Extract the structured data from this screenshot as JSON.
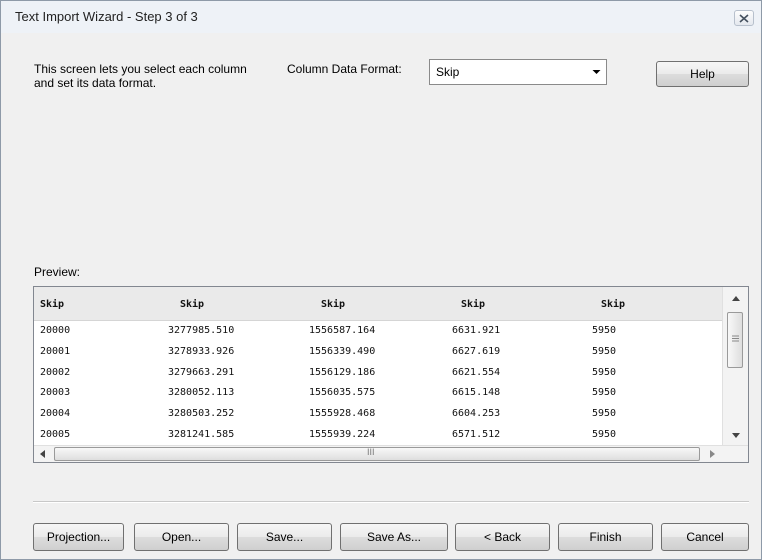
{
  "window": {
    "title": "Text Import Wizard - Step 3 of 3"
  },
  "description": "This screen lets you select each column and set its data format.",
  "column_format": {
    "label": "Column Data Format:",
    "value": "Skip"
  },
  "help_label": "Help",
  "preview": {
    "label": "Preview:",
    "headers": [
      "Skip",
      "Skip",
      "Skip",
      "Skip",
      "Skip"
    ],
    "rows": [
      [
        "20000",
        "3277985.510",
        "1556587.164",
        "6631.921",
        "5950"
      ],
      [
        "20001",
        "3278933.926",
        "1556339.490",
        "6627.619",
        "5950"
      ],
      [
        "20002",
        "3279663.291",
        "1556129.186",
        "6621.554",
        "5950"
      ],
      [
        "20003",
        "3280052.113",
        "1556035.575",
        "6615.148",
        "5950"
      ],
      [
        "20004",
        "3280503.252",
        "1555928.468",
        "6604.253",
        "5950"
      ],
      [
        "20005",
        "3281241.585",
        "1555939.224",
        "6571.512",
        "5950"
      ]
    ],
    "scroll_grip": "III"
  },
  "buttons": {
    "projection": "Projection...",
    "open": "Open...",
    "save": "Save...",
    "save_as": "Save As...",
    "back": "< Back",
    "finish": "Finish",
    "cancel": "Cancel"
  },
  "icons": {
    "close": "close-icon",
    "dropdown": "chevron-down-icon",
    "scroll_up": "scroll-up-icon",
    "scroll_down": "scroll-down-icon",
    "scroll_left": "scroll-left-icon",
    "scroll_right": "scroll-right-icon"
  }
}
